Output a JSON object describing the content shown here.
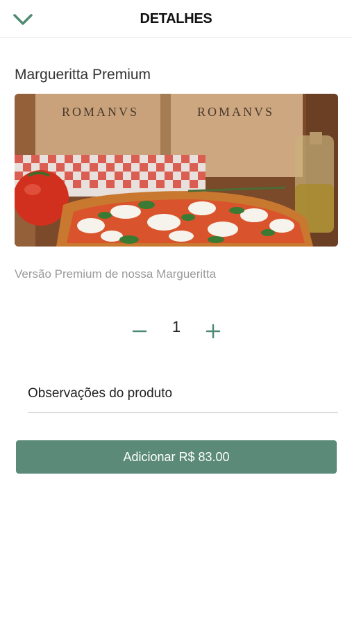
{
  "header": {
    "title": "DETALHES",
    "back_icon": "chevron-down-icon"
  },
  "product": {
    "name": "Margueritta Premium",
    "description": "Versão Premium de nossa Margueritta",
    "image_box_text_left": "ROMANVS",
    "image_box_text_right": "ROMANVS"
  },
  "quantity": {
    "value": "1",
    "minus_label": "−",
    "plus_label": "+"
  },
  "notes": {
    "placeholder": "Observações do produto"
  },
  "add_button": {
    "label": "Adicionar R$ 83.00"
  },
  "colors": {
    "accent": "#5b8b78",
    "button": "#5b8b78"
  }
}
